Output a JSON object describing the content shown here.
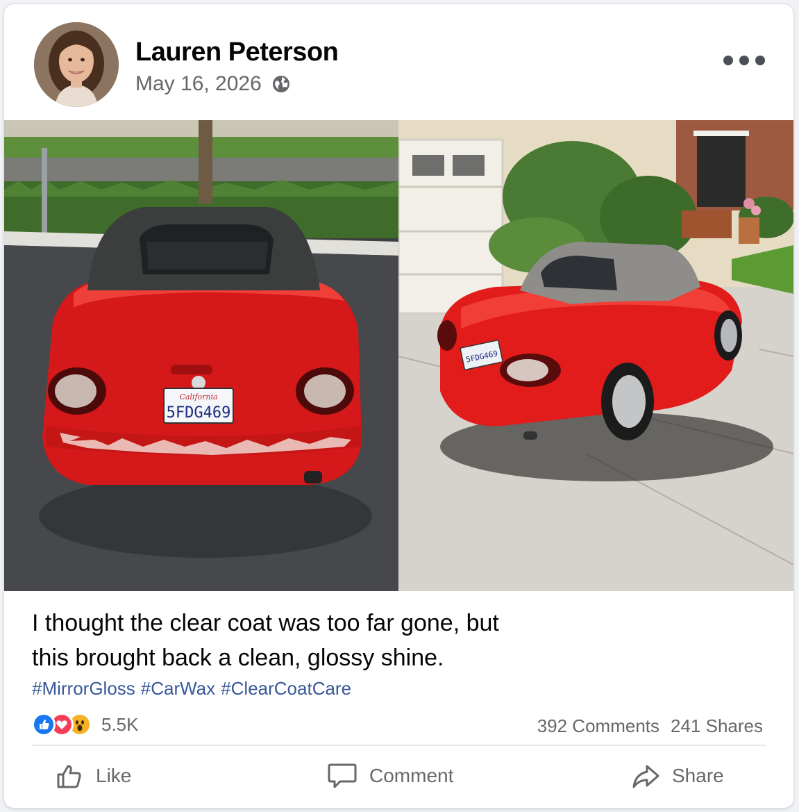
{
  "post": {
    "author": "Lauren Peterson",
    "date": "May 16, 2026",
    "privacy_icon": "globe-icon",
    "caption_line1": "I thought the clear coat was too far gone, but",
    "caption_line2": "this brought back a clean, glossy shine.",
    "hashtags": [
      "#MirrorGloss",
      "#CarWax",
      "#ClearCoatCare"
    ],
    "photos": [
      {
        "plate": "5FDG469",
        "plate_state": "California"
      },
      {
        "plate": "5FDG469"
      }
    ]
  },
  "engagement": {
    "reaction_icons": [
      "like-icon",
      "love-icon",
      "wow-icon"
    ],
    "reaction_count": "5.5K",
    "comments": "392 Comments",
    "shares": "241 Shares"
  },
  "actions": {
    "like": "Like",
    "comment": "Comment",
    "share": "Share"
  },
  "colors": {
    "link_blue": "#385898",
    "like_blue": "#1877f2",
    "love_red": "#f33e58",
    "wow_yellow": "#f7b125",
    "car_red": "#e01b1b"
  }
}
